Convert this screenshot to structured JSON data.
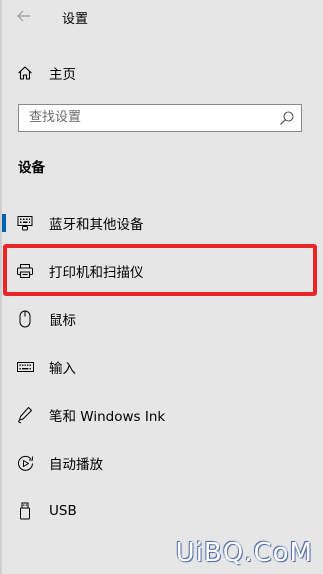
{
  "window": {
    "title": "设置"
  },
  "home": {
    "label": "主页"
  },
  "search": {
    "placeholder": "查找设置",
    "value": ""
  },
  "section": {
    "title": "设备"
  },
  "nav": {
    "items": [
      {
        "label": "蓝牙和其他设备",
        "icon": "keyboard-device-icon",
        "active": true
      },
      {
        "label": "打印机和扫描仪",
        "icon": "printer-icon",
        "active": false,
        "highlighted": true
      },
      {
        "label": "鼠标",
        "icon": "mouse-icon",
        "active": false
      },
      {
        "label": "输入",
        "icon": "keyboard-icon",
        "active": false
      },
      {
        "label": "笔和 Windows Ink",
        "icon": "pen-icon",
        "active": false
      },
      {
        "label": "自动播放",
        "icon": "autoplay-icon",
        "active": false
      },
      {
        "label": "USB",
        "icon": "usb-icon",
        "active": false
      }
    ]
  },
  "colors": {
    "background": "#e6e6e6",
    "accent": "#0063b1",
    "highlight": "#e8262a"
  },
  "watermark": {
    "text": "UiBQ.CoM"
  }
}
